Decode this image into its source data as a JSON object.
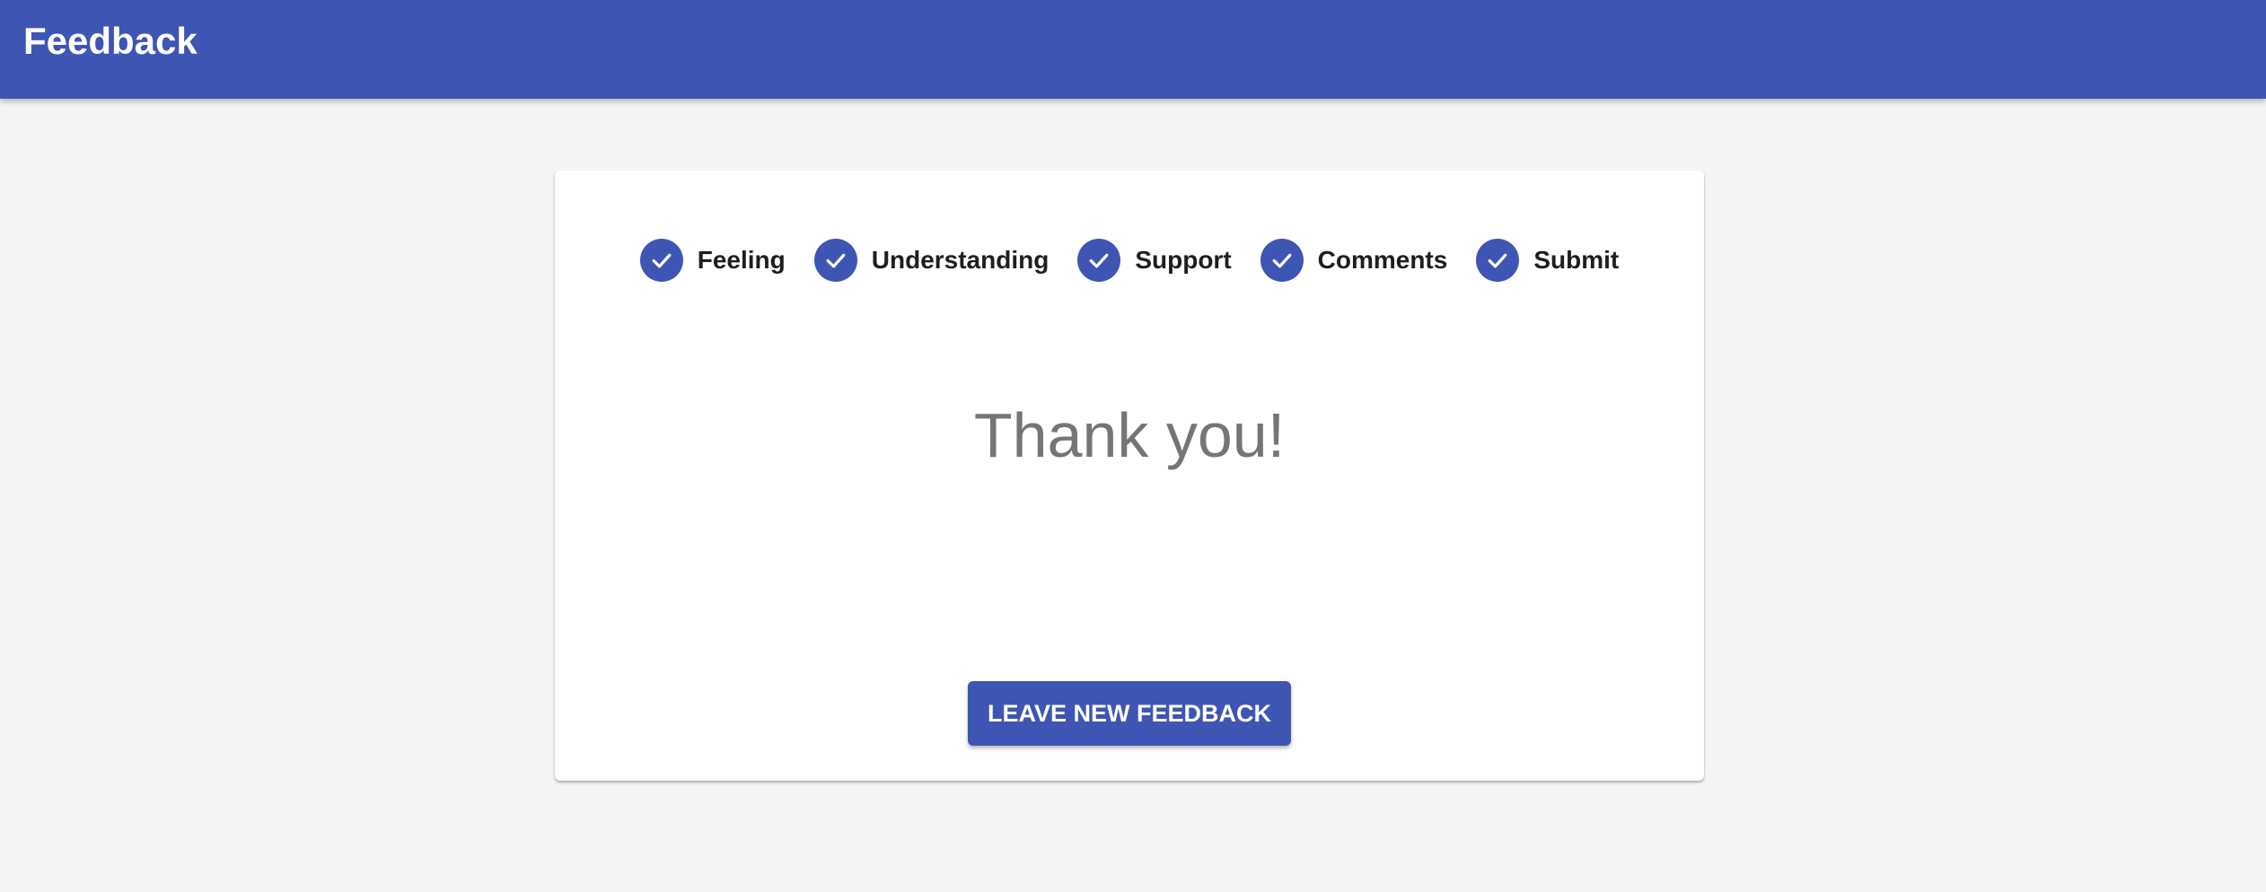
{
  "header": {
    "title": "Feedback",
    "background_color": "#3f55b4"
  },
  "stepper": {
    "steps": [
      {
        "label": "Feeling",
        "status": "completed",
        "icon": "check-circle-icon"
      },
      {
        "label": "Understanding",
        "status": "completed",
        "icon": "check-circle-icon"
      },
      {
        "label": "Support",
        "status": "completed",
        "icon": "check-circle-icon"
      },
      {
        "label": "Comments",
        "status": "completed",
        "icon": "check-circle-icon"
      },
      {
        "label": "Submit",
        "status": "completed",
        "icon": "check-circle-icon"
      }
    ]
  },
  "main": {
    "message": "Thank you!",
    "button_label": "Leave New Feedback"
  },
  "colors": {
    "primary": "#3f55b4",
    "background": "#f4f4f4",
    "card": "#ffffff",
    "message_text": "#757575"
  }
}
